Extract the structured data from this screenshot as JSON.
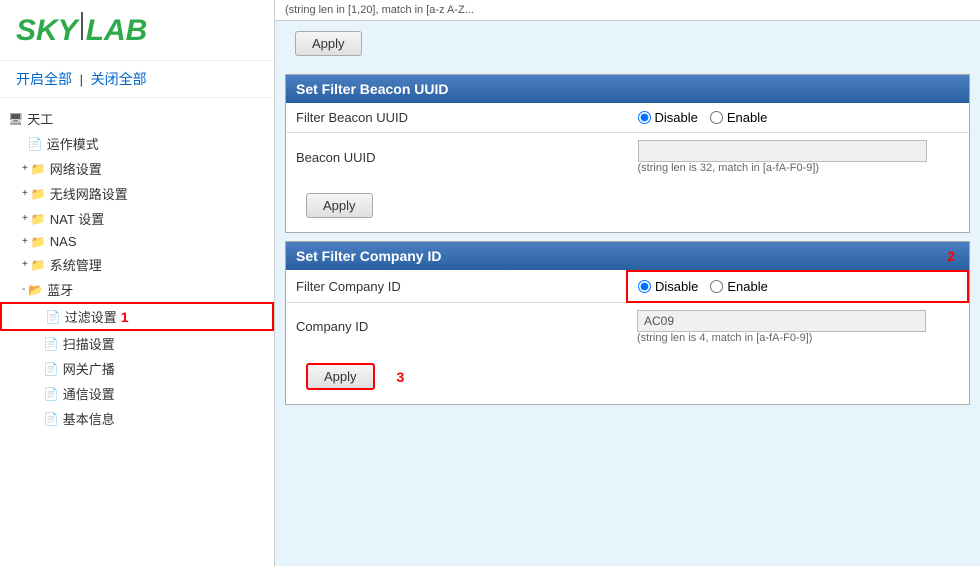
{
  "logo": {
    "text": "SKYLAB"
  },
  "sidebar": {
    "toggle_open": "开启全部",
    "toggle_sep": "|",
    "toggle_close": "关闭全部",
    "root_item": "天工",
    "items": [
      {
        "label": "运作模式",
        "level": 2,
        "type": "file"
      },
      {
        "label": "网络设置",
        "level": 2,
        "type": "folder",
        "expand": "+"
      },
      {
        "label": "无线网路设置",
        "level": 2,
        "type": "folder",
        "expand": "+"
      },
      {
        "label": "NAT 设置",
        "level": 2,
        "type": "folder",
        "expand": "+"
      },
      {
        "label": "NAS",
        "level": 2,
        "type": "folder",
        "expand": "+"
      },
      {
        "label": "系统管理",
        "level": 2,
        "type": "folder",
        "expand": "+"
      },
      {
        "label": "蓝牙",
        "level": 2,
        "type": "folder",
        "expand": "-"
      },
      {
        "label": "过滤设置",
        "level": 3,
        "type": "file",
        "selected": true
      },
      {
        "label": "扫描设置",
        "level": 3,
        "type": "file"
      },
      {
        "label": "网关广播",
        "level": 3,
        "type": "file"
      },
      {
        "label": "通信设置",
        "level": 3,
        "type": "file"
      },
      {
        "label": "基本信息",
        "level": 3,
        "type": "file"
      }
    ],
    "number_label": "1"
  },
  "main": {
    "top_partial_text": "(string len in [1,20], match in [a-z A-Z...",
    "apply_btn_1": "Apply",
    "sections": [
      {
        "id": "beacon_uuid",
        "header": "Set Filter Beacon UUID",
        "rows": [
          {
            "label": "Filter Beacon UUID",
            "type": "radio",
            "options": [
              "Disable",
              "Enable"
            ],
            "selected": "Disable"
          },
          {
            "label": "Beacon UUID",
            "type": "input_hint",
            "value": "",
            "hint": "(string len is 32, match in [a-fA-F0-9])"
          }
        ],
        "apply_label": "Apply"
      },
      {
        "id": "company_id",
        "header": "Set Filter Company ID",
        "number_label": "2",
        "rows": [
          {
            "label": "Filter Company ID",
            "type": "radio",
            "options": [
              "Disable",
              "Enable"
            ],
            "selected": "Disable",
            "highlight": true
          },
          {
            "label": "Company ID",
            "type": "input_hint",
            "value": "AC09",
            "hint": "(string len is 4, match in [a-fA-F0-9])"
          }
        ],
        "apply_label": "Apply",
        "apply_highlight": true,
        "number_label_apply": "3"
      }
    ]
  }
}
